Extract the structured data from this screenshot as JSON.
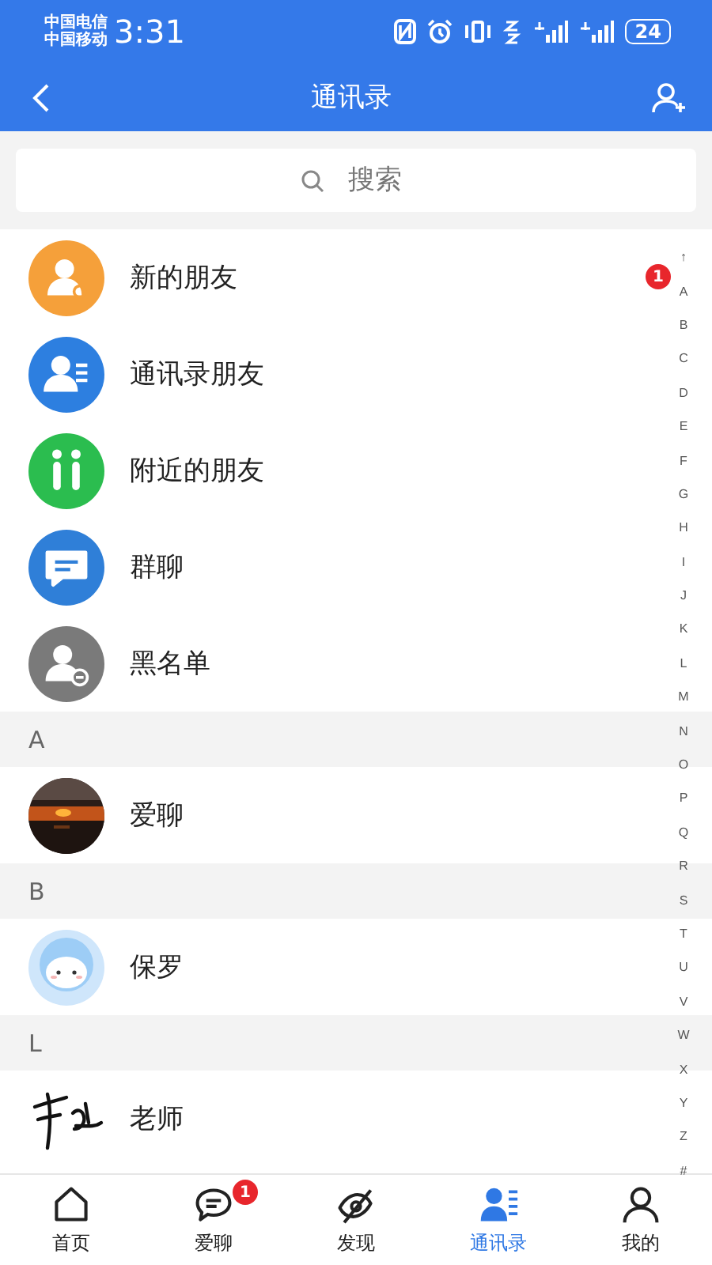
{
  "status_bar": {
    "carriers": [
      "中国电信",
      "中国移动"
    ],
    "time": "3:31",
    "battery": "24"
  },
  "header": {
    "title": "通讯录"
  },
  "search": {
    "placeholder": "搜索"
  },
  "functions": [
    {
      "kind": "new-friends",
      "label": "新的朋友",
      "color": "#f5a03a",
      "badge": "1"
    },
    {
      "kind": "phone-contacts",
      "label": "通讯录朋友",
      "color": "#2d7fe0"
    },
    {
      "kind": "nearby",
      "label": "附近的朋友",
      "color": "#2bbd4f"
    },
    {
      "kind": "group-chat",
      "label": "群聊",
      "color": "#2f7fd8"
    },
    {
      "kind": "blacklist",
      "label": "黑名单",
      "color": "#7a7a7a"
    }
  ],
  "sections": [
    {
      "letter": "A",
      "contacts": [
        {
          "name": "爱聊"
        }
      ]
    },
    {
      "letter": "B",
      "contacts": [
        {
          "name": "保罗"
        }
      ]
    },
    {
      "letter": "L",
      "contacts": [
        {
          "name": "老师"
        }
      ]
    }
  ],
  "index": [
    "↑",
    "A",
    "B",
    "C",
    "D",
    "E",
    "F",
    "G",
    "H",
    "I",
    "J",
    "K",
    "L",
    "M",
    "N",
    "O",
    "P",
    "Q",
    "R",
    "S",
    "T",
    "U",
    "V",
    "W",
    "X",
    "Y",
    "Z",
    "#"
  ],
  "tabs": [
    {
      "kind": "home",
      "label": "首页",
      "selected": false
    },
    {
      "kind": "chat",
      "label": "爱聊",
      "selected": false,
      "badge": "1"
    },
    {
      "kind": "discover",
      "label": "发现",
      "selected": false
    },
    {
      "kind": "contacts",
      "label": "通讯录",
      "selected": true
    },
    {
      "kind": "me",
      "label": "我的",
      "selected": false
    }
  ]
}
